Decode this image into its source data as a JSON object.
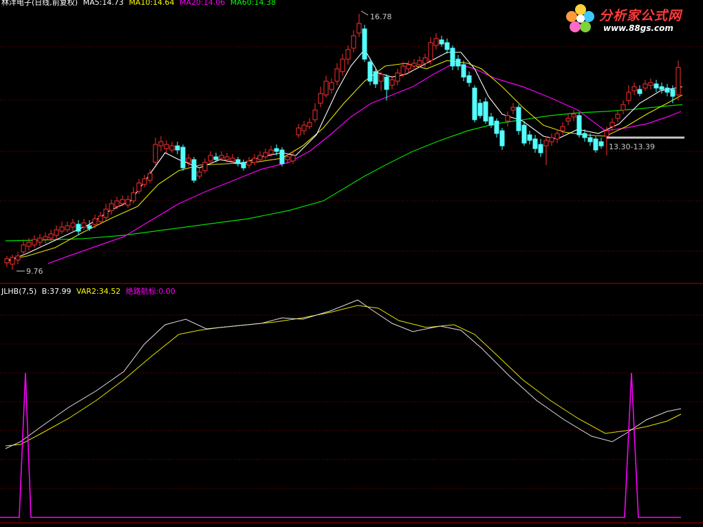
{
  "chart_data": [
    {
      "type": "line",
      "panel": "main-price",
      "title": "林洋电子(日线,前复权)",
      "series": [
        {
          "name": "MA5",
          "value": "14.73"
        },
        {
          "name": "MA10",
          "value": "14.64"
        },
        {
          "name": "MA20",
          "value": "14.06"
        },
        {
          "name": "MA60",
          "value": "14.38"
        }
      ],
      "annotations": {
        "high_label": "16.78",
        "low_label": "9.76",
        "range_label": "13.30-13.39"
      }
    },
    {
      "type": "line",
      "panel": "indicator",
      "title": "JLHB(7,5)",
      "series": [
        {
          "name": "B",
          "value": "37.99"
        },
        {
          "name": "VAR2",
          "value": "34.52"
        },
        {
          "name": "绝路航标",
          "value": "0.00"
        }
      ]
    }
  ],
  "legend_top": {
    "title": "林洋电子(日线,前复权)",
    "ma5": "MA5:14.73",
    "ma10": "MA10:14.64",
    "ma20": "MA20:14.06",
    "ma60": "MA60:14.38"
  },
  "legend_bottom": {
    "title": "JLHB(7,5)",
    "b": "B:37.99",
    "var2": "VAR2:34.52",
    "signal": "绝路航标:0.00"
  },
  "labels": {
    "high": "16.78",
    "low": "9.76",
    "range": "13.30-13.39"
  },
  "logo": {
    "name": "分析家公式网",
    "url": "www.88gs.com"
  },
  "colors": {
    "up": "#ff3030",
    "down": "#54ffff",
    "ma5": "#ffffff",
    "ma10": "#ffff00",
    "ma20": "#ff00ff",
    "ma60": "#00ff00",
    "grid": "#b00000",
    "signal": "#ff00ff"
  }
}
